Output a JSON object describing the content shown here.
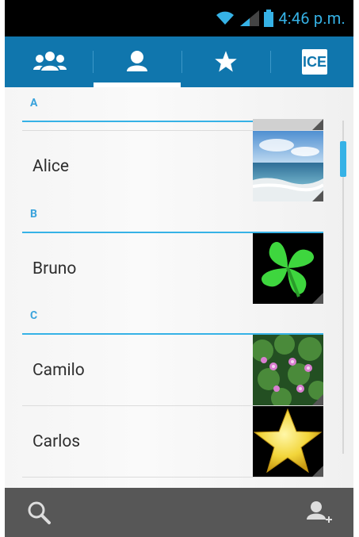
{
  "status_bar": {
    "time": "4:46 p.m."
  },
  "tabs": [
    {
      "icon": "groups-icon"
    },
    {
      "icon": "person-icon"
    },
    {
      "icon": "star-icon"
    },
    {
      "label": "ICE"
    }
  ],
  "sections": [
    {
      "letter": "A"
    },
    {
      "letter": "B"
    },
    {
      "letter": "C"
    }
  ],
  "contacts": [
    {
      "name": "Alice",
      "photo": "ocean-photo"
    },
    {
      "name": "Bruno",
      "photo": "clover-photo"
    },
    {
      "name": "Camilo",
      "photo": "flowers-photo"
    },
    {
      "name": "Carlos",
      "photo": "star-photo"
    }
  ],
  "colors": {
    "accent": "#36b2e6",
    "tab_bar": "#1076ad",
    "bottom_bar": "#575757"
  },
  "bottom_bar": {
    "left_icon": "search-icon",
    "right_icon": "add-contact-icon"
  }
}
